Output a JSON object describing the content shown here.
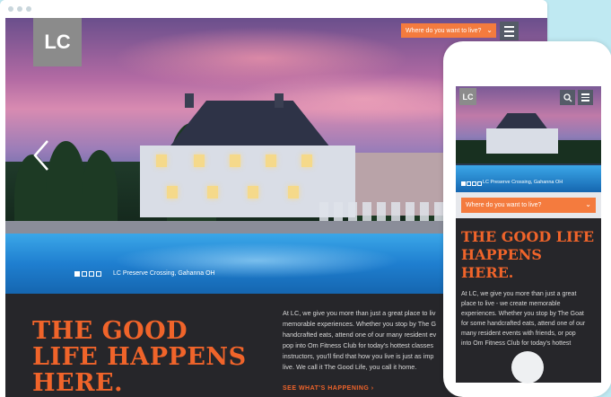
{
  "desktop": {
    "logo": "LC",
    "search_placeholder": "Where do you want to live?",
    "hero_caption": "LC Preserve Crossing, Gahanna OH",
    "headline": "THE GOOD LIFE HAPPENS HERE.",
    "body_lines": [
      "At LC, we give you more than just a great place to liv",
      "memorable experiences. Whether you stop by The G",
      "handcrafted eats, attend one of our many resident ev",
      "pop into Om Fitness Club for today's hottest classes",
      "instructors, you'll find that how you live is just as imp",
      "live. We call it The Good Life, you call it home."
    ],
    "cta": "SEE WHAT'S HAPPENING  ›"
  },
  "mobile": {
    "logo": "LC",
    "hero_caption": "LC Preserve Crossing, Gahanna OH",
    "search_placeholder": "Where do you want to live?",
    "headline": "THE GOOD LIFE HAPPENS HERE.",
    "body_lines": [
      "At LC, we give you more than just a great",
      "place to live - we create memorable",
      "experiences. Whether you stop by The Goat",
      "for some handcrafted eats, attend one of our",
      "many resident events with friends, or pop",
      "into Om Fitness Club for today's hottest"
    ]
  },
  "icons": {
    "menu": "hamburger-icon",
    "prev": "chevron-left-icon",
    "search": "search-icon",
    "dropdown": "chevron-down-icon"
  },
  "colors": {
    "accent": "#f47b3e",
    "headline": "#f0642a",
    "band": "#26262a",
    "background": "#bfe9f2"
  }
}
